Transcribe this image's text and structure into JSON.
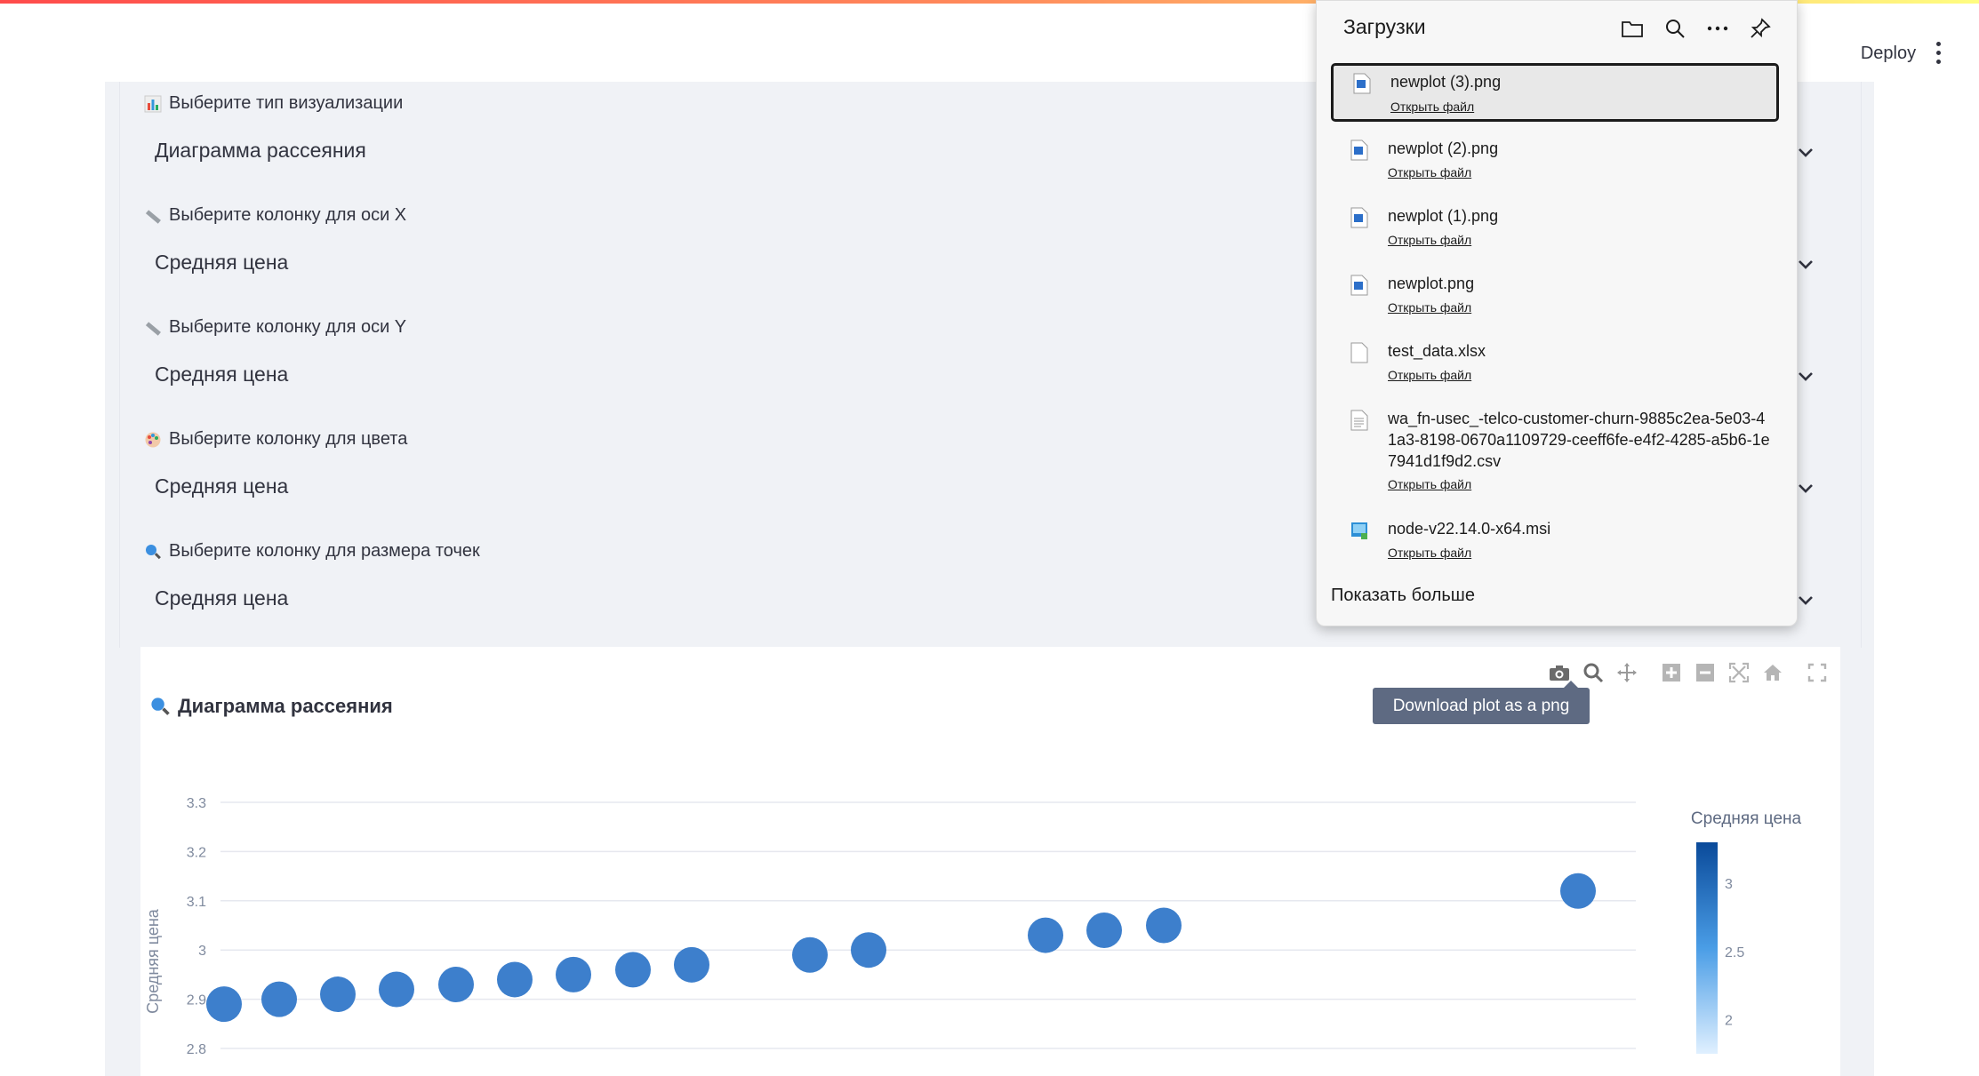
{
  "header": {
    "deploy_label": "Deploy"
  },
  "form": {
    "fields": [
      {
        "label": "Выберите тип визуализации",
        "value": "Диаграмма рассеяния",
        "icon": "bar-chart-icon"
      },
      {
        "label": "Выберите колонку для оси X",
        "value": "Средняя цена",
        "icon": "ruler-icon"
      },
      {
        "label": "Выберите колонку для оси Y",
        "value": "Средняя цена",
        "icon": "ruler-icon"
      },
      {
        "label": "Выберите колонку для цвета",
        "value": "Средняя цена",
        "icon": "palette-icon"
      },
      {
        "label": "Выберите колонку для размера точек",
        "value": "Средняя цена",
        "icon": "magnifier-icon"
      }
    ]
  },
  "plot": {
    "title": "Диаграмма рассеяния",
    "tooltip": "Download plot as a png"
  },
  "downloads": {
    "title": "Загрузки",
    "show_more": "Показать больше",
    "items": [
      {
        "name": "newplot (3).png",
        "action": "Открыть файл",
        "icon": "image-file-icon"
      },
      {
        "name": "newplot (2).png",
        "action": "Открыть файл",
        "icon": "image-file-icon"
      },
      {
        "name": "newplot (1).png",
        "action": "Открыть файл",
        "icon": "image-file-icon"
      },
      {
        "name": "newplot.png",
        "action": "Открыть файл",
        "icon": "image-file-icon"
      },
      {
        "name": "test_data.xlsx",
        "action": "Открыть файл",
        "icon": "blank-file-icon"
      },
      {
        "name": "wa_fn-usec_-telco-customer-churn-9885c2ea-5e03-41a3-8198-0670a1109729-ceeff6fe-e4f2-4285-a5b6-1e7941d1f9d2.csv",
        "action": "Открыть файл",
        "icon": "text-file-icon"
      },
      {
        "name": "node-v22.14.0-x64.msi",
        "action": "Открыть файл",
        "icon": "installer-file-icon"
      }
    ]
  },
  "chart_data": {
    "type": "scatter",
    "ylabel": "Средняя цена",
    "yticks": [
      "3.3",
      "3.2",
      "3.1",
      "3",
      "2.9",
      "2.8"
    ],
    "ylim": [
      2.8,
      3.3
    ],
    "colorbar_title": "Средняя цена",
    "colorbar_ticks": [
      "3",
      "2.5",
      "2"
    ],
    "points": [
      {
        "y": 2.89
      },
      {
        "y": 2.9
      },
      {
        "y": 2.91
      },
      {
        "y": 2.92
      },
      {
        "y": 2.93
      },
      {
        "y": 2.94
      },
      {
        "y": 2.95
      },
      {
        "y": 2.96
      },
      {
        "y": 2.97
      },
      {
        "y": 2.99
      },
      {
        "y": 3.0
      },
      {
        "y": 3.03
      },
      {
        "y": 3.04
      },
      {
        "y": 3.05
      },
      {
        "y": 3.12
      }
    ],
    "marker_color": "#3d7fcc"
  }
}
